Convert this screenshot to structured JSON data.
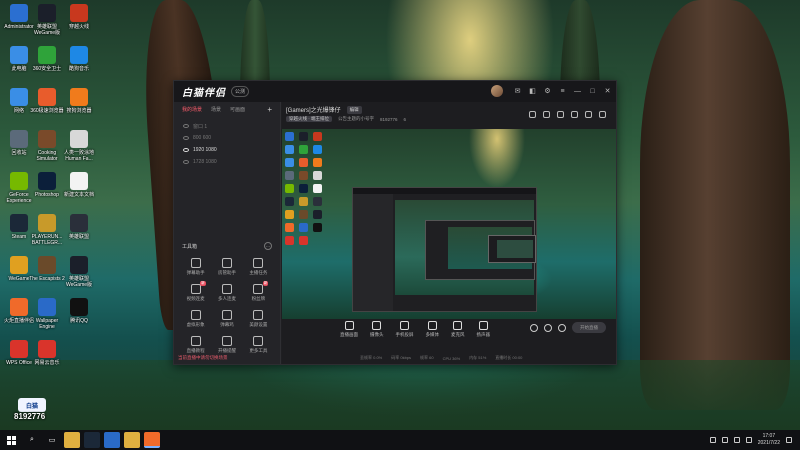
{
  "desktop": {
    "icons": [
      {
        "label": "Administrator",
        "icon": "user-folder-icon",
        "color": "#2b6fd1"
      },
      {
        "label": "英雄联盟 WeGame版",
        "icon": "lol-icon",
        "color": "#1b1f2a"
      },
      {
        "label": "穿越火线",
        "icon": "cf-icon",
        "color": "#c8381e"
      },
      {
        "label": "此电脑",
        "icon": "computer-icon",
        "color": "#3a8ee6"
      },
      {
        "label": "360安全卫士",
        "icon": "360-icon",
        "color": "#2fa33a"
      },
      {
        "label": "酷狗音乐",
        "icon": "kugou-icon",
        "color": "#1e88e5"
      },
      {
        "label": "网络",
        "icon": "network-icon",
        "color": "#3a8ee6"
      },
      {
        "label": "360极速浏览器",
        "icon": "browser-icon",
        "color": "#e85c2c"
      },
      {
        "label": "搜狗浏览器",
        "icon": "sogou-icon",
        "color": "#f07b1c"
      },
      {
        "label": "回收站",
        "icon": "recycle-bin-icon",
        "color": "#5b6a7a"
      },
      {
        "label": "Cooking Simulator",
        "icon": "cooking-icon",
        "color": "#7a4a2a"
      },
      {
        "label": "人类一败涂地 Human Fa...",
        "icon": "human-icon",
        "color": "#d8d8d8"
      },
      {
        "label": "GeForce Experience",
        "icon": "nvidia-icon",
        "color": "#76b900"
      },
      {
        "label": "Photoshop",
        "icon": "photoshop-icon",
        "color": "#0b1f3a"
      },
      {
        "label": "新建文本文档",
        "icon": "text-file-icon",
        "color": "#f3f3f3"
      },
      {
        "label": "Steam",
        "icon": "steam-icon",
        "color": "#1b2838"
      },
      {
        "label": "PLAYERUN... BATTLEGR...",
        "icon": "pubg-icon",
        "color": "#c89a2a"
      },
      {
        "label": "英雄联盟",
        "icon": "lol2-icon",
        "color": "#2a2f3a"
      },
      {
        "label": "WeGame",
        "icon": "wegame-icon",
        "color": "#e0a020"
      },
      {
        "label": "The Escapists 2",
        "icon": "escapists-icon",
        "color": "#6a4a2a"
      },
      {
        "label": "英雄联盟 WeGame版",
        "icon": "lol3-icon",
        "color": "#1b1f2a"
      },
      {
        "label": "火炬直播伴侣",
        "icon": "torch-icon",
        "color": "#f06a2a"
      },
      {
        "label": "Wallpaper Engine",
        "icon": "wallpaper-icon",
        "color": "#2a6ac8"
      },
      {
        "label": "腾讯QQ",
        "icon": "qq-icon",
        "color": "#111111"
      },
      {
        "label": "WPS Office",
        "icon": "wps-icon",
        "color": "#d9342b"
      },
      {
        "label": "网易云音乐",
        "icon": "netease-icon",
        "color": "#d9342b"
      }
    ]
  },
  "window": {
    "logo": "白猫伴侣",
    "version": "公测",
    "tabs": [
      "我的场景",
      "场景",
      "可画面"
    ],
    "sources": [
      {
        "label": "窗口 1",
        "on": false
      },
      {
        "label": "800 600",
        "on": false
      },
      {
        "label": "1920 1080",
        "on": true
      },
      {
        "label": "1728 1080",
        "on": false
      }
    ],
    "toolbox_title": "工具箱",
    "tools": [
      {
        "label": "弹幕助手",
        "tag": ""
      },
      {
        "label": "房管助手",
        "tag": ""
      },
      {
        "label": "主播任务",
        "tag": ""
      },
      {
        "label": "视频连麦",
        "tag": "新"
      },
      {
        "label": "多人连麦",
        "tag": ""
      },
      {
        "label": "粉丝牌",
        "tag": "新"
      },
      {
        "label": "虚拟形象",
        "tag": ""
      },
      {
        "label": "弹幕鸡",
        "tag": ""
      },
      {
        "label": "美颜设置",
        "tag": ""
      },
      {
        "label": "直播教程",
        "tag": ""
      },
      {
        "label": "开播提醒",
        "tag": ""
      },
      {
        "label": "更多工具",
        "tag": ""
      }
    ],
    "notice": "当前直播中请勿切换场景",
    "room_title": "[Gamers]之光爆锋仔",
    "room_tag": "编辑",
    "sub_tag": "穿越火线 · 端王排位",
    "sub_text": "公告主题的小号字",
    "room_id": "8192776",
    "viewers": "6",
    "controls": [
      "直播画面",
      "摄像头",
      "手机投屏",
      "多媒体",
      "麦克风",
      "扬声器"
    ],
    "live_button": "开始直播",
    "status": [
      "丢帧率 0.0%",
      "码率 0kbps",
      "帧率 60",
      "CPU 36%",
      "内存 51%",
      "直播时长 00:00"
    ]
  },
  "watermark": {
    "logo": "白猫",
    "id": "8192776"
  },
  "taskbar": {
    "apps": [
      "file-explorer-icon",
      "steam-icon",
      "media-icon",
      "folder-icon",
      "camera-app-icon"
    ],
    "time": "17:07",
    "date": "2021/7/22"
  }
}
